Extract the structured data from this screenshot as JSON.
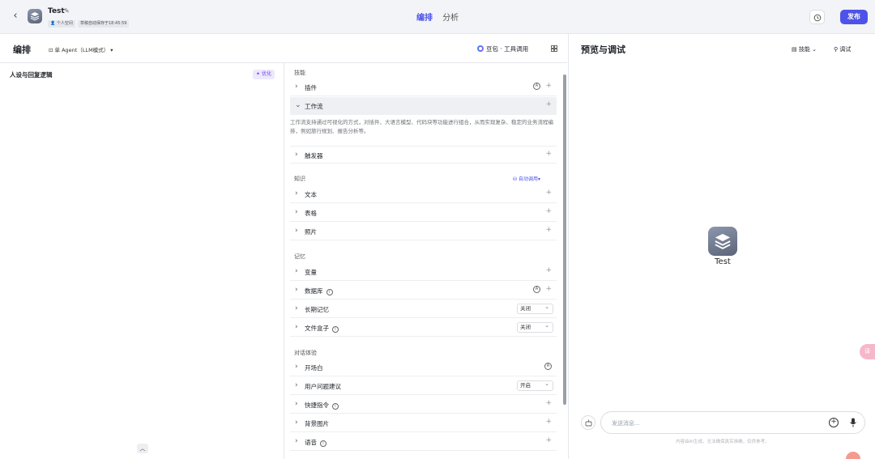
{
  "topbar": {
    "back_icon": "chevron-left-icon",
    "app_name": "Test",
    "workspace": "个人空间",
    "autosave": "草稿自动保存于18:45:59",
    "tabs": [
      {
        "label": "编排",
        "active": true
      },
      {
        "label": "分析",
        "active": false
      }
    ],
    "publish_label": "发布",
    "accent_color": "#4d53e8"
  },
  "editor": {
    "title": "编排",
    "mode": "单 Agent（LLM模式）",
    "model": "豆包 · 工具调用"
  },
  "prompt": {
    "title": "人设与回复逻辑",
    "optimize_label": "优化"
  },
  "skills": {
    "sections": {
      "skills": "技能",
      "knowledge": "知识",
      "memory": "记忆",
      "dialog": "对话体验"
    },
    "plugin": "插件",
    "workflow": "工作流",
    "workflow_desc": "工作流支持通过可视化的方式，对插件、大语言模型、代码块等功能进行组合，从而实现复杂、稳定的业务流程编排，例如旅行规划、报告分析等。",
    "trigger": "触发器",
    "auto_call": "自动调用",
    "text": "文本",
    "table": "表格",
    "photo": "照片",
    "variable": "变量",
    "database": "数据库",
    "long_memory": "长期记忆",
    "long_memory_value": "关闭",
    "file_box": "文件盒子",
    "file_box_value": "关闭",
    "opening": "开场白",
    "suggest": "用户问题建议",
    "suggest_value": "开启",
    "shortcut": "快捷指令",
    "background": "背景图片",
    "voice": "语音"
  },
  "preview": {
    "title": "预览与调试",
    "skills_label": "技能",
    "debug_label": "调试",
    "bot_name": "Test",
    "input_placeholder": "发送消息...",
    "disclaimer": "内容由AI生成，无法确保真实准确，仅供参考。",
    "translate_label": "译"
  }
}
